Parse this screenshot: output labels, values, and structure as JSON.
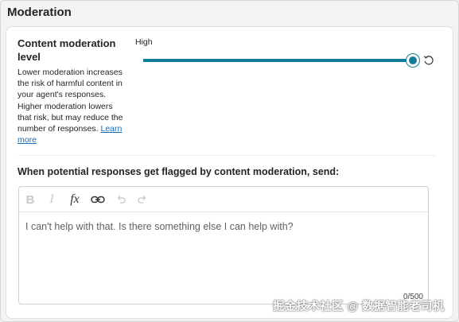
{
  "section": {
    "title": "Moderation"
  },
  "moderation_level": {
    "title": "Content moderation level",
    "description": "Lower moderation increases the risk of harmful content in your agent's responses. Higher moderation lowers that risk, but may reduce the number of responses.",
    "learn_more": "Learn more",
    "slider_label": "High",
    "slider_value": 1.0,
    "accent_color": "#107c9e",
    "reset_icon": "reset-icon"
  },
  "flagged": {
    "label": "When potential responses get flagged by content moderation, send:",
    "toolbar": [
      "bold-icon",
      "italic-icon",
      "function-icon",
      "link-icon",
      "undo-icon",
      "redo-icon"
    ],
    "text": "I can't help with that. Is there something else I can help with?",
    "char_count": "0/500"
  },
  "watermark": "掘金技术社区 @ 数据智能老司机"
}
